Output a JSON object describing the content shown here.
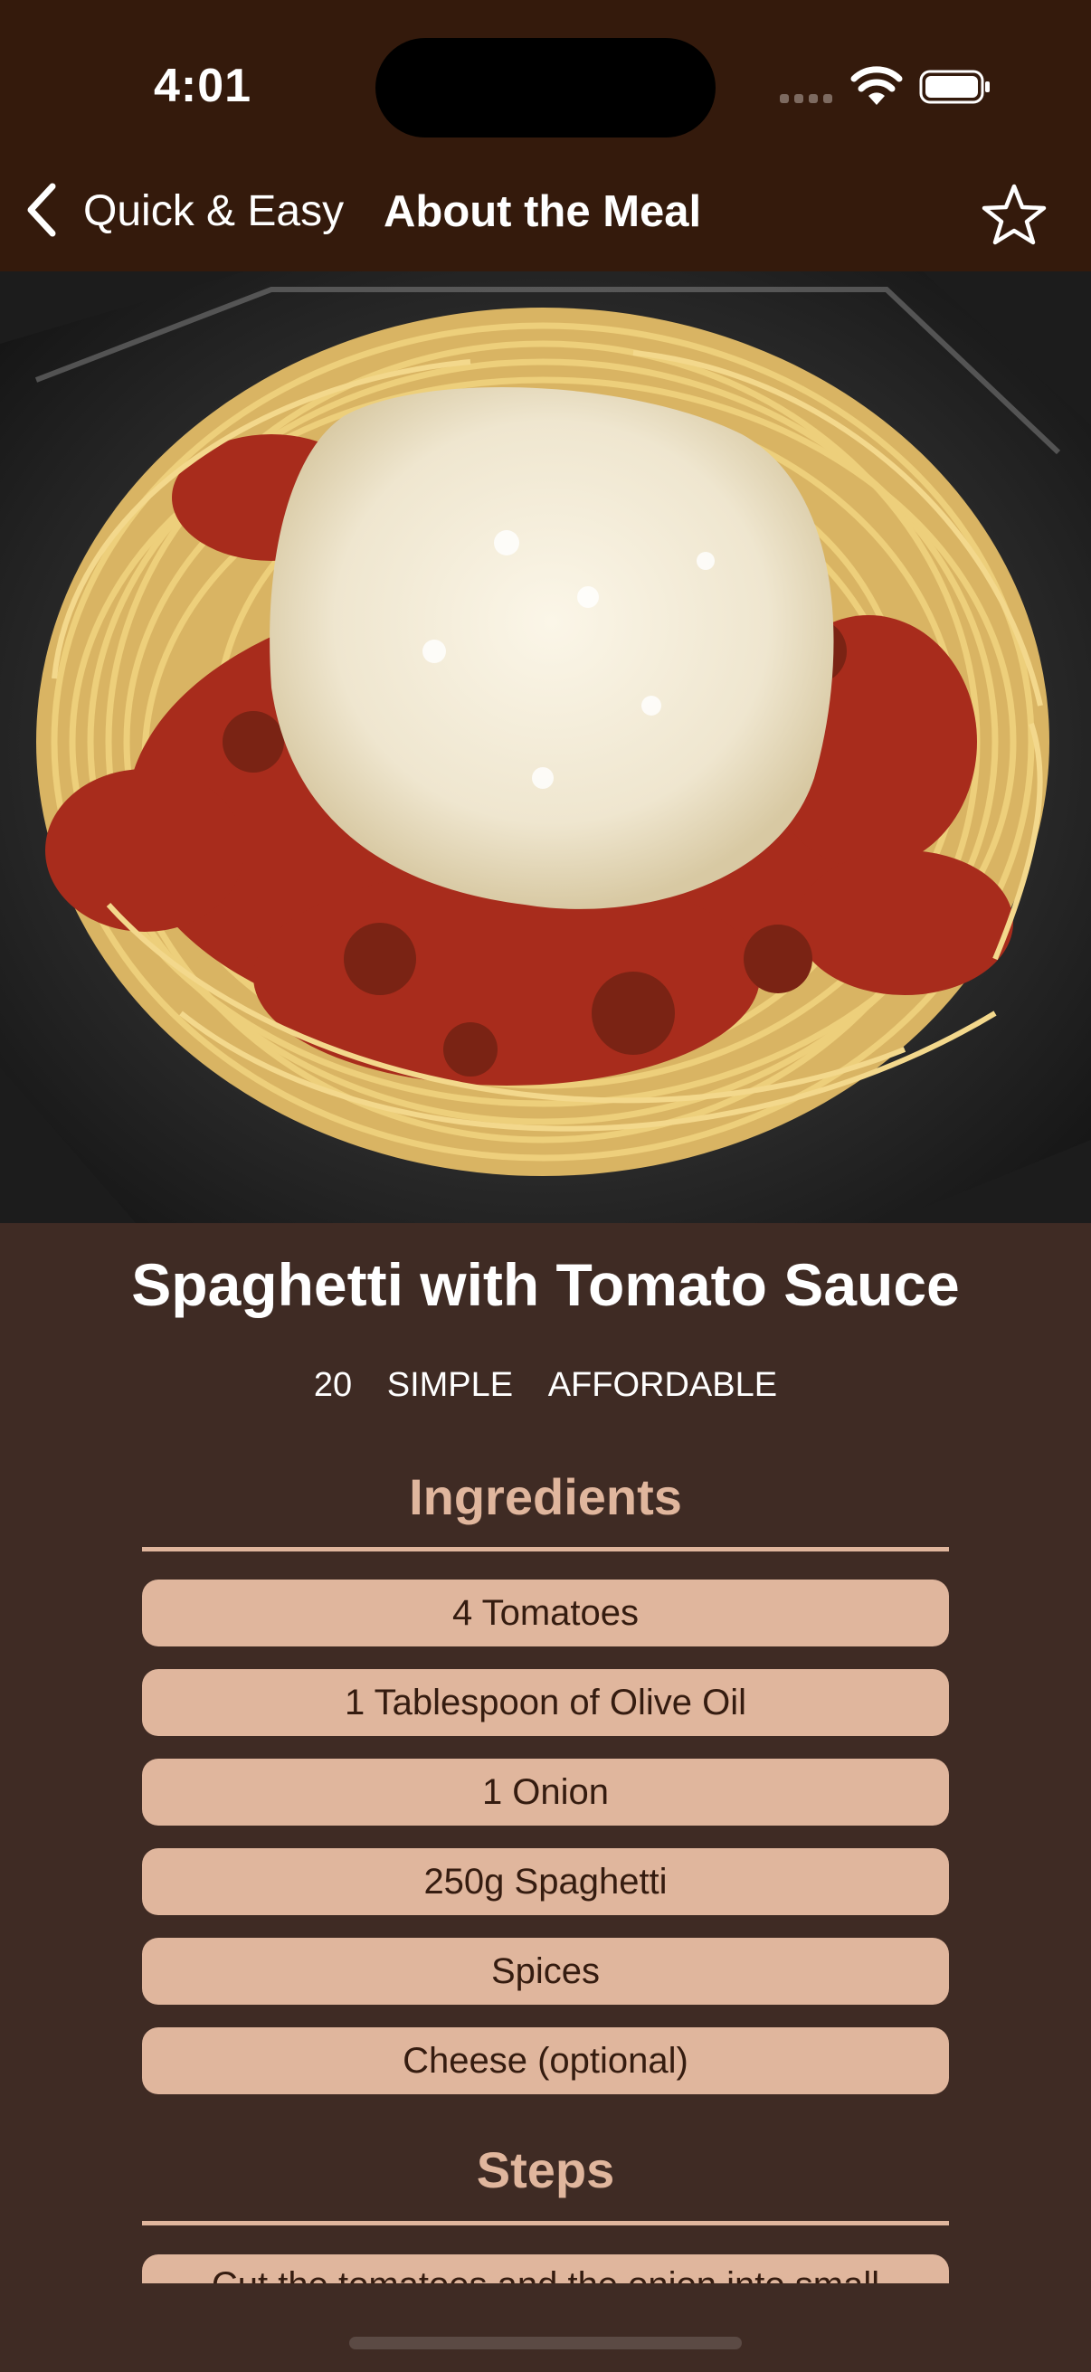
{
  "status_bar": {
    "time": "4:01"
  },
  "nav": {
    "back_label": "Quick & Easy",
    "title": "About the Meal"
  },
  "meal": {
    "title": "Spaghetti with Tomato Sauce",
    "duration": "20",
    "complexity": "SIMPLE",
    "affordability": "AFFORDABLE"
  },
  "sections": {
    "ingredients_title": "Ingredients",
    "steps_title": "Steps"
  },
  "ingredients": [
    "4 Tomatoes",
    "1 Tablespoon of Olive Oil",
    "1 Onion",
    "250g Spaghetti",
    "Spices",
    "Cheese (optional)"
  ],
  "steps": [
    "Cut the tomatoes and the onion into small"
  ],
  "colors": {
    "header_bg": "#341a0c",
    "page_bg": "#3f2b24",
    "accent": "#e0b69d",
    "pill_text": "#351c10"
  }
}
